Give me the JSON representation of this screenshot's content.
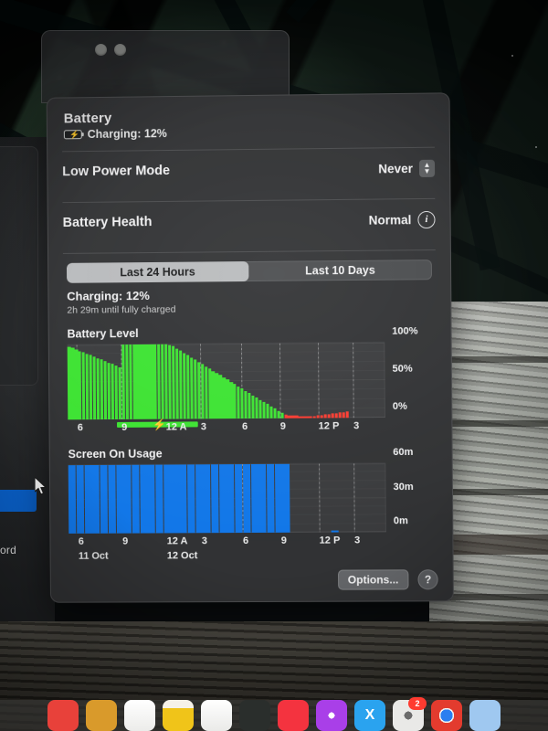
{
  "window": {
    "traffic_lights": [
      "close",
      "minimize",
      "zoom"
    ]
  },
  "background": {
    "field_label": "ord"
  },
  "battery": {
    "section_title": "Battery",
    "charge_status": "Charging: 12%",
    "battery_icon": "battery-charging-icon",
    "rows": [
      {
        "label": "Low Power Mode",
        "value": "Never",
        "control": "stepper-popup"
      },
      {
        "label": "Battery Health",
        "value": "Normal",
        "control": "info-button"
      }
    ],
    "tabs": [
      {
        "label": "Last 24 Hours",
        "selected": true
      },
      {
        "label": "Last 10 Days",
        "selected": false
      }
    ],
    "status": {
      "headline": "Charging: 12%",
      "detail": "2h 29m until fully charged"
    },
    "footer": {
      "options_label": "Options...",
      "help_label": "?"
    }
  },
  "chart_data": [
    {
      "type": "bar",
      "title": "Battery Level",
      "id": "battery-level",
      "xlabel": "",
      "ylabel": "",
      "ylim": [
        0,
        100
      ],
      "ytick_labels": [
        "100%",
        "50%",
        "0%"
      ],
      "ytick_values": [
        100,
        50,
        0
      ],
      "xtick_labels": [
        "6",
        "9",
        "12 A",
        "3",
        "6",
        "9",
        "12 P",
        "3"
      ],
      "xtick_positions": [
        0.03,
        0.17,
        0.31,
        0.42,
        0.55,
        0.67,
        0.79,
        0.9
      ],
      "grid": true,
      "colors": {
        "normal": "#3ce331",
        "low": "#ff3b30",
        "charging_bar": "#3ce331"
      },
      "charging_period": {
        "start": 0.155,
        "end": 0.41,
        "label": "charging-bolt"
      },
      "values": [
        98,
        96,
        94,
        92,
        90,
        88,
        86,
        84,
        82,
        80,
        78,
        76,
        74,
        72,
        70,
        100,
        100,
        100,
        100,
        100,
        100,
        100,
        100,
        100,
        100,
        100,
        100,
        100,
        99,
        97,
        94,
        91,
        88,
        85,
        82,
        79,
        76,
        73,
        70,
        67,
        64,
        61,
        58,
        55,
        52,
        49,
        46,
        43,
        40,
        37,
        34,
        31,
        28,
        25,
        22,
        19,
        16,
        13,
        10,
        7,
        5,
        4,
        4,
        4,
        3,
        3,
        3,
        3,
        3,
        4,
        4,
        5,
        5,
        6,
        6,
        7,
        7,
        8,
        0,
        0,
        0,
        0,
        0,
        0,
        0,
        0,
        0,
        0
      ],
      "low_threshold_index": 60
    },
    {
      "type": "bar",
      "title": "Screen On Usage",
      "id": "screen-on-usage",
      "xlabel": "",
      "ylabel": "",
      "ylim": [
        0,
        60
      ],
      "ytick_labels": [
        "60m",
        "30m",
        "0m"
      ],
      "ytick_values": [
        60,
        30,
        0
      ],
      "xtick_labels": [
        "6",
        "9",
        "12 A",
        "3",
        "6",
        "9",
        "12 P",
        "3"
      ],
      "xtick_positions": [
        0.03,
        0.17,
        0.31,
        0.42,
        0.55,
        0.67,
        0.79,
        0.9
      ],
      "day_labels": [
        {
          "text": "11 Oct",
          "position": 0.03
        },
        {
          "text": "12 Oct",
          "position": 0.31
        }
      ],
      "grid": true,
      "color": "#1277e8",
      "values": [
        60,
        60,
        60,
        60,
        60,
        60,
        60,
        60,
        60,
        60,
        60,
        60,
        60,
        60,
        60,
        60,
        60,
        60,
        60,
        60,
        60,
        60,
        60,
        60,
        60,
        60,
        60,
        60,
        0,
        0,
        0,
        0,
        0,
        2,
        0,
        0,
        0,
        0,
        0,
        0
      ]
    }
  ],
  "dock": {
    "apps": [
      {
        "name": "safari",
        "color": "#e8413a",
        "glyph": ""
      },
      {
        "name": "podcasts",
        "color": "#d99a2b",
        "glyph": ""
      },
      {
        "name": "reminders",
        "color": "#f4f4f2",
        "glyph": ""
      },
      {
        "name": "notes",
        "color": "#f0c419",
        "glyph": ""
      },
      {
        "name": "facetime",
        "color": "#f4f4f2",
        "glyph": ""
      },
      {
        "name": "tv",
        "color": "#2a2e2c",
        "glyph": ""
      },
      {
        "name": "music",
        "color": "#f4333f",
        "glyph": ""
      },
      {
        "name": "podcasts-purple",
        "color": "#a93fe8",
        "glyph": ""
      },
      {
        "name": "x-twitter",
        "color": "#2aa3ef",
        "glyph": "X"
      },
      {
        "name": "system-settings",
        "color": "#e9e9e7",
        "glyph": "",
        "badge": "2"
      },
      {
        "name": "chrome",
        "color": "#f4f4f2",
        "glyph": ""
      },
      {
        "name": "app-blue",
        "color": "#9fc8f0",
        "glyph": ""
      }
    ]
  }
}
